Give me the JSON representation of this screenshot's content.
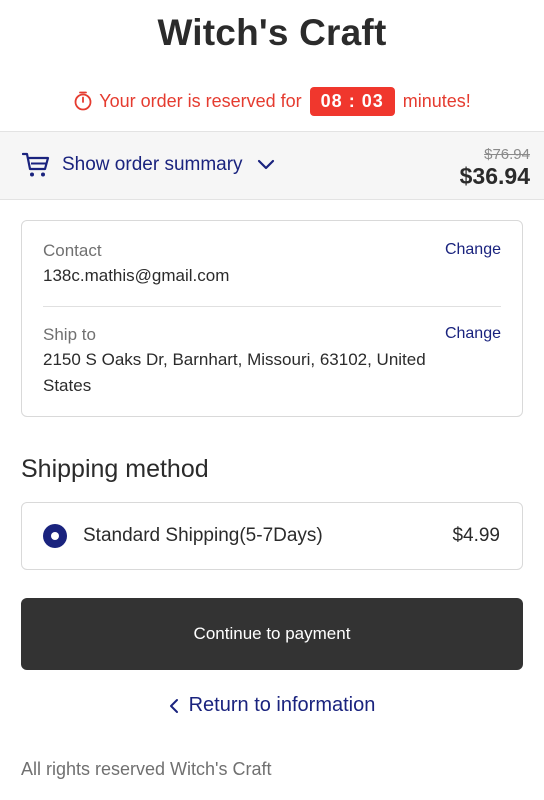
{
  "store": {
    "title": "Witch's Craft"
  },
  "reservation": {
    "prefix": "Your order is reserved for",
    "timer": "08 : 03",
    "suffix": "minutes!",
    "icon": "timer-icon",
    "color": "#e53b2f"
  },
  "order_summary": {
    "toggle_label": "Show order summary",
    "cart_icon": "cart-icon",
    "chevron_icon": "chevron-down-icon",
    "original_price": "$76.94",
    "total_price": "$36.94"
  },
  "contact": {
    "label": "Contact",
    "value": "138c.mathis@gmail.com",
    "change_label": "Change"
  },
  "ship_to": {
    "label": "Ship to",
    "value": "2150 S Oaks Dr, Barnhart, Missouri, 63102, United States",
    "change_label": "Change"
  },
  "shipping_method": {
    "heading": "Shipping method",
    "options": [
      {
        "name": "Standard Shipping(5-7Days)",
        "price": "$4.99",
        "selected": true
      }
    ]
  },
  "actions": {
    "continue_label": "Continue to payment",
    "return_label": "Return to information"
  },
  "footer": {
    "text": "All rights reserved Witch's Craft"
  },
  "colors": {
    "accent": "#1a237e",
    "button": "#333333",
    "timer_badge": "#f0372d"
  }
}
